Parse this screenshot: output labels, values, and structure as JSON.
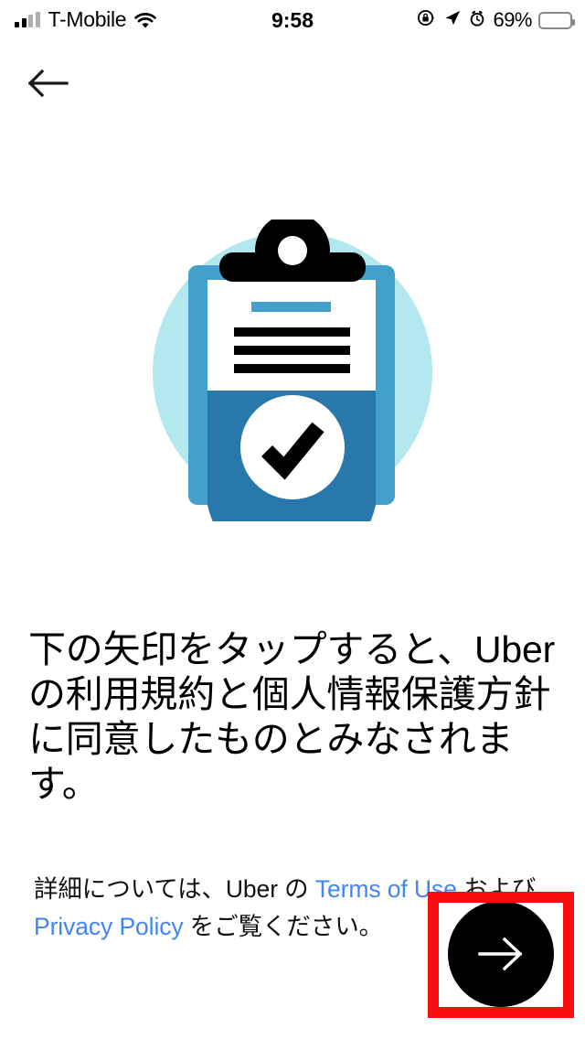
{
  "status_bar": {
    "carrier": "T-Mobile",
    "time": "9:58",
    "battery_percent": "69%",
    "icons": {
      "signal": "signal-bars-icon",
      "wifi": "wifi-icon",
      "rotation_lock": "rotation-lock-icon",
      "location": "location-arrow-icon",
      "alarm": "alarm-clock-icon",
      "battery": "battery-icon"
    }
  },
  "nav": {
    "back_label": "back-arrow"
  },
  "illustration": {
    "name": "clipboard-checkmark-illustration",
    "colors": {
      "circle_bg": "#b3e8ee",
      "clipboard_light": "#42a0cb",
      "clipboard_dark": "#2878ab",
      "paper": "#ffffff",
      "accent_line": "#42a0cb",
      "text_lines": "#000000",
      "clip": "#000000",
      "check": "#000000"
    }
  },
  "main": {
    "heading": "下の矢印をタップすると、Uber の利用規約と個人情報保護方針に同意したものとみなされます。",
    "legal": {
      "part1": "詳細については、Uber の ",
      "link1": "Terms of Use",
      "part2": " および ",
      "link2": "Privacy Policy",
      "part3": " をご覧ください。"
    }
  },
  "fab": {
    "label": "next-arrow",
    "background": "#000000",
    "arrow_color": "#ffffff"
  },
  "annotation": {
    "highlight_color": "#fc0d0d"
  }
}
